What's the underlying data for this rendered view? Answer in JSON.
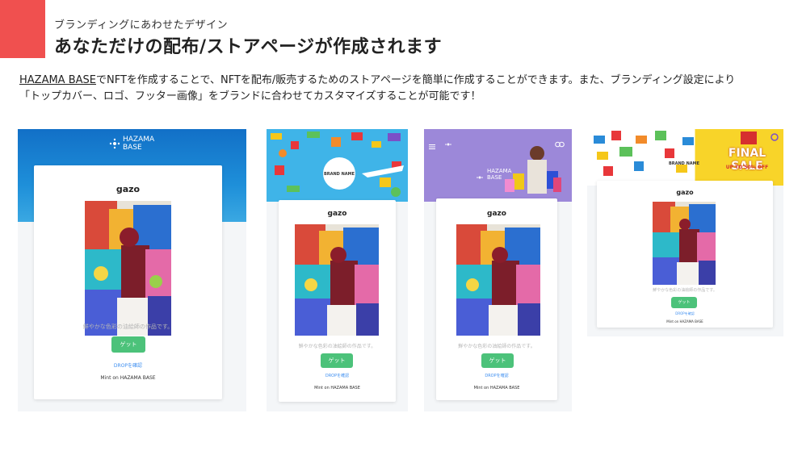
{
  "header": {
    "subtitle": "ブランディングにあわせたデザイン",
    "title": "あなただけの配布/ストアページが作成されます"
  },
  "description": {
    "link_text": "HAZAMA BASE",
    "line1_rest": "でNFTを作成することで、NFTを配布/販売するためのストアページを簡単に作成することができます。また、ブランディング設定により",
    "line2": "「トップカバー、ロゴ、フッター画像」をブランドに合わせてカスタマイズすることが可能です！"
  },
  "examples": [
    {
      "brand_text": "HAZAMA BASE",
      "card_title": "gazo",
      "caption": "鮮やかな色彩の油絵師の作品です。",
      "get_button": "ゲット",
      "drop_link": "DROPを確認",
      "mint_text": "Mint on HAZAMA BASE"
    },
    {
      "banner_label": "BRAND NAME",
      "card_title": "gazo",
      "caption": "鮮やかな色彩の油絵師の作品です。",
      "get_button": "ゲット",
      "drop_link": "DROPを確認",
      "mint_text": "Mint on HAZAMA BASE"
    },
    {
      "brand_text": "HAZAMA BASE",
      "card_title": "gazo",
      "caption": "鮮やかな色彩の油絵師の作品です。",
      "get_button": "ゲット",
      "drop_link": "DROPを確認",
      "mint_text": "Mint on HAZAMA BASE"
    },
    {
      "banner_label": "BRAND NAME",
      "sale_title": "FINAL SALE",
      "sale_sub": "UP TO 50% OFF",
      "card_title": "gazo",
      "caption": "鮮やかな色彩の油絵師の作品です。",
      "get_button": "ゲット",
      "drop_link": "DROPを確認",
      "mint_text": "Mint on HAZAMA BASE"
    }
  ],
  "colors": {
    "accent": "#f0504f",
    "get_button": "#4cc27a",
    "drop_link": "#3d8ef0",
    "banner1": "#1677c9",
    "banner3": "#9b87d8",
    "sale_yellow": "#f8d429"
  }
}
